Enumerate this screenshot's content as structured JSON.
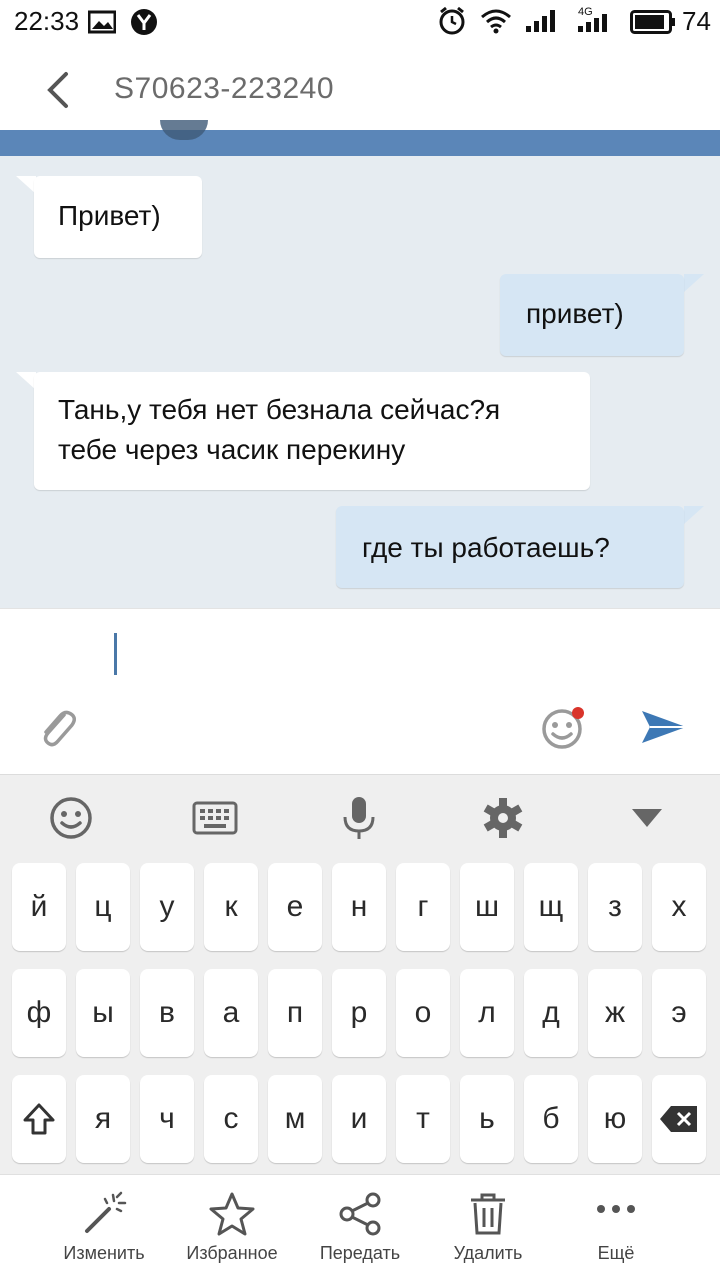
{
  "status_bar": {
    "time": "22:33",
    "battery": "74",
    "network": "4G"
  },
  "header": {
    "title": "S70623-223240"
  },
  "messages": [
    {
      "direction": "in",
      "text": "Привет)"
    },
    {
      "direction": "out",
      "text": "привет)"
    },
    {
      "direction": "in",
      "text_line1": "Тань,у тебя нет безнала сейчас?я",
      "text_line2": "тебе через часик перекину"
    },
    {
      "direction": "out",
      "text": "где ты работаешь?"
    }
  ],
  "input": {
    "value": ""
  },
  "keyboard": {
    "row1": [
      "й",
      "ц",
      "у",
      "к",
      "е",
      "н",
      "г",
      "ш",
      "щ",
      "з",
      "х"
    ],
    "row2": [
      "ф",
      "ы",
      "в",
      "а",
      "п",
      "р",
      "о",
      "л",
      "д",
      "ж",
      "э"
    ],
    "row3": [
      "я",
      "ч",
      "с",
      "м",
      "и",
      "т",
      "ь",
      "б",
      "ю"
    ]
  },
  "actions": [
    {
      "label": "Изменить",
      "icon": "magic-wand-icon"
    },
    {
      "label": "Избранное",
      "icon": "star-icon"
    },
    {
      "label": "Передать",
      "icon": "share-icon"
    },
    {
      "label": "Удалить",
      "icon": "trash-icon"
    },
    {
      "label": "Ещё",
      "icon": "more-icon"
    }
  ],
  "colors": {
    "accent": "#5b86b8",
    "chat_bg": "#e6ecf1",
    "out_bubble": "#d6e6f4",
    "send": "#3d78b5"
  }
}
